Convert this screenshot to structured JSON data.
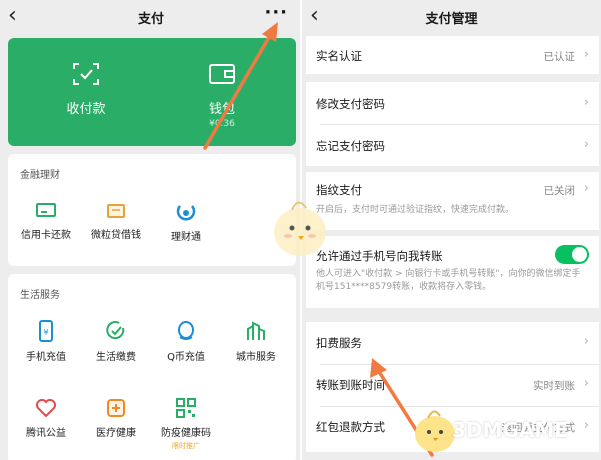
{
  "left": {
    "title": "支付",
    "back_icon": "chevron-left-icon",
    "more_icon": "more-dots-icon",
    "more_label": "···",
    "green_card": {
      "items": [
        {
          "label": "收付款",
          "icon": "scan-qr-icon"
        },
        {
          "label": "钱包",
          "sub": "¥0.36",
          "icon": "wallet-icon"
        }
      ]
    },
    "finance": {
      "title": "金融理财",
      "items": [
        {
          "label": "信用卡还款",
          "icon": "credit-card-icon"
        },
        {
          "label": "微粒贷借钱",
          "icon": "loan-icon"
        },
        {
          "label": "理财通",
          "icon": "wealth-icon"
        }
      ]
    },
    "life": {
      "title": "生活服务",
      "items": [
        {
          "label": "手机充值",
          "icon": "phone-icon"
        },
        {
          "label": "生活缴费",
          "icon": "bill-check-icon"
        },
        {
          "label": "Q币充值",
          "icon": "qq-icon"
        },
        {
          "label": "城市服务",
          "icon": "city-icon"
        },
        {
          "label": "腾讯公益",
          "icon": "charity-heart-icon"
        },
        {
          "label": "医疗健康",
          "icon": "medical-icon"
        },
        {
          "label": "防疫健康码",
          "icon": "health-code-icon",
          "promo": "限时推广"
        }
      ]
    }
  },
  "right": {
    "title": "支付管理",
    "rows": {
      "realname": {
        "label": "实名认证",
        "value": "已认证"
      },
      "change_pwd": {
        "label": "修改支付密码"
      },
      "forgot_pwd": {
        "label": "忘记支付密码"
      },
      "fingerprint": {
        "label": "指纹支付",
        "value": "已关闭",
        "desc": "开启后，支付时可通过验证指纹，快速完成付款。"
      },
      "phone_transfer": {
        "label": "允许通过手机号向我转账",
        "toggle": true,
        "desc": "他人可进入\"收付款 > 向银行卡或手机号转账\"，向你的微信绑定手机号151****8579转账，收款将存入零钱。"
      },
      "deduction": {
        "label": "扣费服务"
      },
      "transfer_time": {
        "label": "转账到账时间",
        "value": "实时到账"
      },
      "redpacket_refund": {
        "label": "红包退款方式",
        "value": "退回原支付方式"
      }
    }
  },
  "watermark": "3DMGAME",
  "colors": {
    "green": "#2aae67",
    "toggle": "#07c160",
    "arrow": "#f07a42"
  }
}
